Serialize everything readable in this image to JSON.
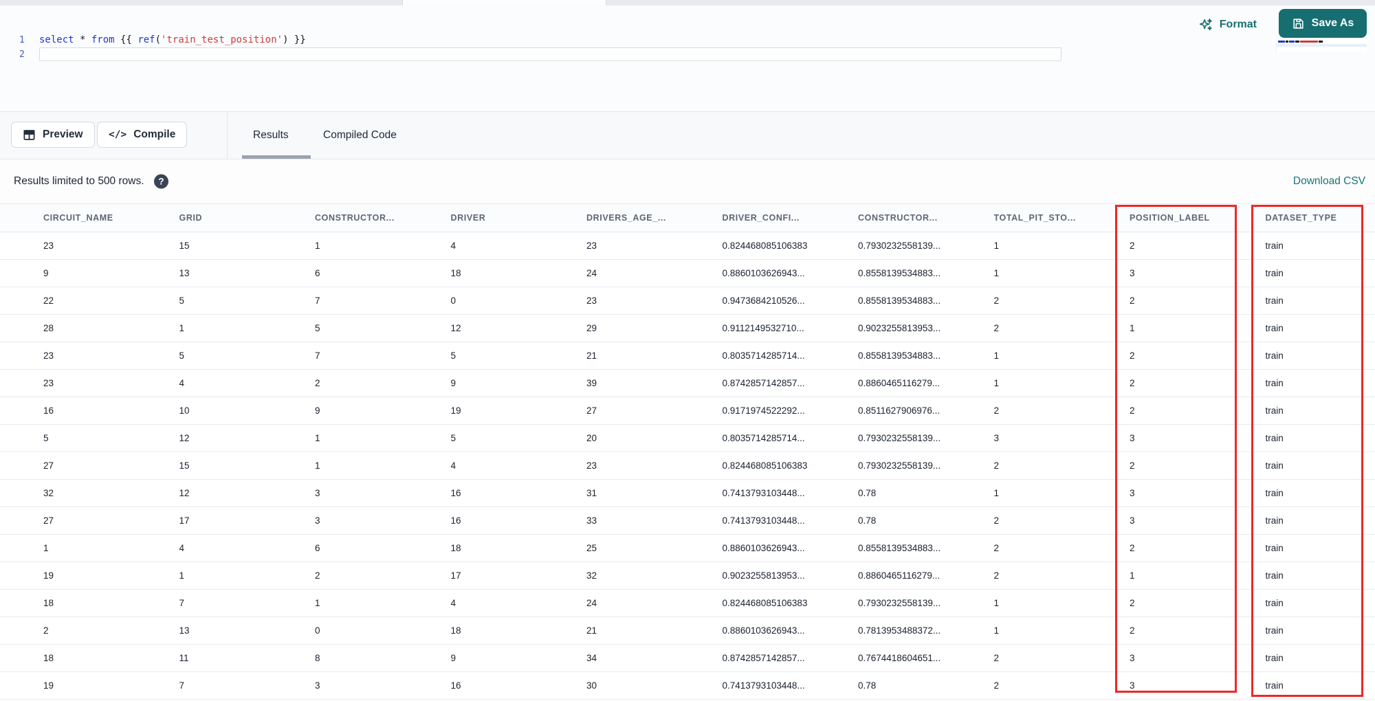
{
  "editor": {
    "line_numbers": [
      "1",
      "2"
    ],
    "code_tokens": [
      {
        "text": "select",
        "type": "keyword"
      },
      {
        "text": " * ",
        "type": "plain"
      },
      {
        "text": "from",
        "type": "keyword"
      },
      {
        "text": " {{ ",
        "type": "plain"
      },
      {
        "text": "ref",
        "type": "keyword"
      },
      {
        "text": "(",
        "type": "plain"
      },
      {
        "text": "'train_test_position'",
        "type": "string"
      },
      {
        "text": ") }}",
        "type": "plain"
      }
    ]
  },
  "header_actions": {
    "format_label": "Format",
    "save_as_label": "Save As"
  },
  "toolbar": {
    "preview_label": "Preview",
    "compile_label": "Compile",
    "tabs": [
      {
        "label": "Results",
        "active": true
      },
      {
        "label": "Compiled Code",
        "active": false
      }
    ]
  },
  "results_bar": {
    "limit_text": "Results limited to 500 rows.",
    "help_icon_glyph": "?",
    "download_label": "Download CSV"
  },
  "table": {
    "columns": [
      "CIRCUIT_NAME",
      "GRID",
      "CONSTRUCTOR...",
      "DRIVER",
      "DRIVERS_AGE_...",
      "DRIVER_CONFI...",
      "CONSTRUCTOR...",
      "TOTAL_PIT_STO...",
      "POSITION_LABEL",
      "DATASET_TYPE"
    ],
    "highlighted_columns": [
      "POSITION_LABEL",
      "DATASET_TYPE"
    ],
    "rows": [
      [
        "23",
        "15",
        "1",
        "4",
        "23",
        "0.824468085106383",
        "0.7930232558139...",
        "1",
        "2",
        "train"
      ],
      [
        "9",
        "13",
        "6",
        "18",
        "24",
        "0.8860103626943...",
        "0.8558139534883...",
        "1",
        "3",
        "train"
      ],
      [
        "22",
        "5",
        "7",
        "0",
        "23",
        "0.9473684210526...",
        "0.8558139534883...",
        "2",
        "2",
        "train"
      ],
      [
        "28",
        "1",
        "5",
        "12",
        "29",
        "0.9112149532710...",
        "0.9023255813953...",
        "2",
        "1",
        "train"
      ],
      [
        "23",
        "5",
        "7",
        "5",
        "21",
        "0.8035714285714...",
        "0.8558139534883...",
        "1",
        "2",
        "train"
      ],
      [
        "23",
        "4",
        "2",
        "9",
        "39",
        "0.8742857142857...",
        "0.8860465116279...",
        "1",
        "2",
        "train"
      ],
      [
        "16",
        "10",
        "9",
        "19",
        "27",
        "0.9171974522292...",
        "0.8511627906976...",
        "2",
        "2",
        "train"
      ],
      [
        "5",
        "12",
        "1",
        "5",
        "20",
        "0.8035714285714...",
        "0.7930232558139...",
        "3",
        "3",
        "train"
      ],
      [
        "27",
        "15",
        "1",
        "4",
        "23",
        "0.824468085106383",
        "0.7930232558139...",
        "2",
        "2",
        "train"
      ],
      [
        "32",
        "12",
        "3",
        "16",
        "31",
        "0.7413793103448...",
        "0.78",
        "1",
        "3",
        "train"
      ],
      [
        "27",
        "17",
        "3",
        "16",
        "33",
        "0.7413793103448...",
        "0.78",
        "2",
        "3",
        "train"
      ],
      [
        "1",
        "4",
        "6",
        "18",
        "25",
        "0.8860103626943...",
        "0.8558139534883...",
        "2",
        "2",
        "train"
      ],
      [
        "19",
        "1",
        "2",
        "17",
        "32",
        "0.9023255813953...",
        "0.8860465116279...",
        "2",
        "1",
        "train"
      ],
      [
        "18",
        "7",
        "1",
        "4",
        "24",
        "0.824468085106383",
        "0.7930232558139...",
        "1",
        "2",
        "train"
      ],
      [
        "2",
        "13",
        "0",
        "18",
        "21",
        "0.8860103626943...",
        "0.7813953488372...",
        "1",
        "2",
        "train"
      ],
      [
        "18",
        "11",
        "8",
        "9",
        "34",
        "0.8742857142857...",
        "0.7674418604651...",
        "2",
        "3",
        "train"
      ],
      [
        "19",
        "7",
        "3",
        "16",
        "30",
        "0.7413793103448...",
        "0.78",
        "2",
        "3",
        "train"
      ]
    ]
  },
  "colors": {
    "accent_teal": "#176E70",
    "link_teal": "#17747A",
    "highlight_red": "#EE2724",
    "keyword_blue": "#2038C0",
    "string_red": "#CE3C38"
  }
}
